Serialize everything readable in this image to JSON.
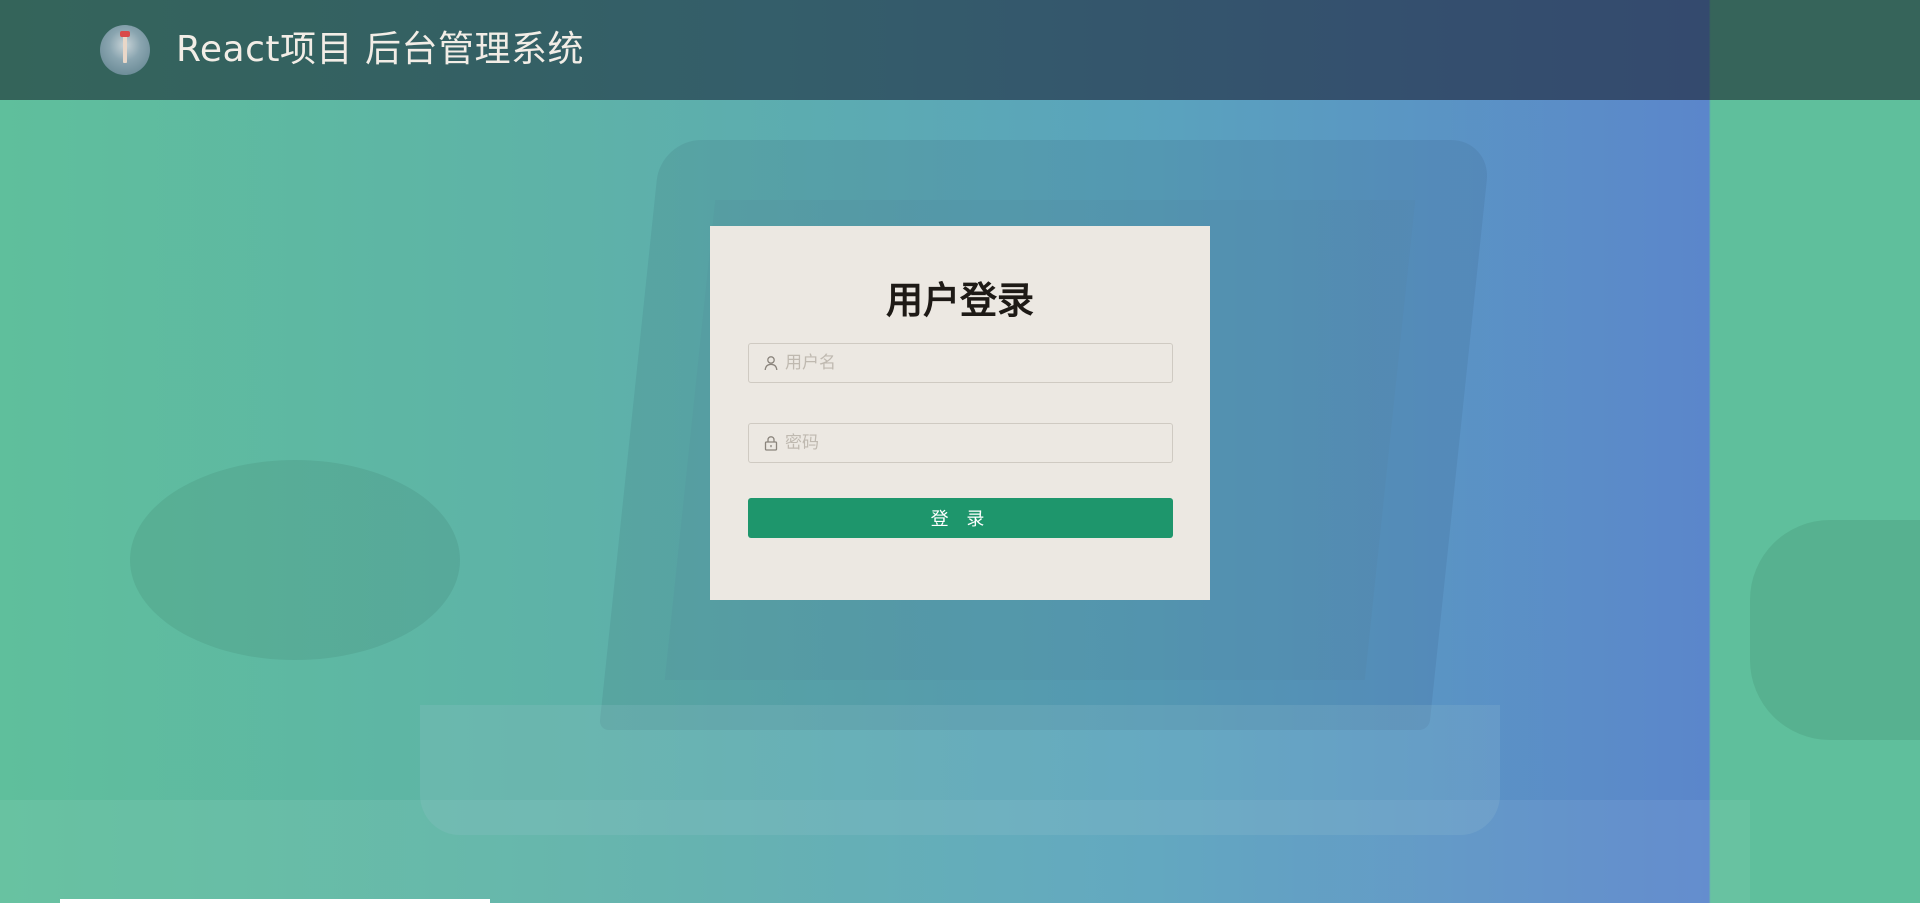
{
  "header": {
    "title": "React项目 后台管理系统"
  },
  "login": {
    "title": "用户登录",
    "username": {
      "placeholder": "用户名",
      "value": "",
      "icon": "user-icon"
    },
    "password": {
      "placeholder": "密码",
      "value": "",
      "icon": "lock-icon"
    },
    "submit_label": "登 录"
  },
  "colors": {
    "header_bg": "#34645a",
    "card_bg": "#ece8e2",
    "button_bg": "#1e966c",
    "background_start": "#5fbf9c",
    "background_end": "#5b86cb"
  }
}
